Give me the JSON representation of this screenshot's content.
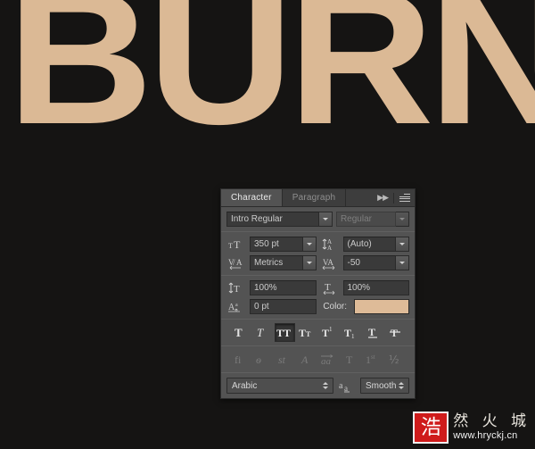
{
  "canvas": {
    "background_color": "#151413",
    "artwork_text": "BURN",
    "artwork_color": "#dbb995"
  },
  "panel": {
    "tabs": [
      {
        "label": "Character",
        "active": true
      },
      {
        "label": "Paragraph",
        "active": false
      }
    ],
    "header_icons": {
      "collapse": "double-chevron-right-icon",
      "menu": "panel-menu-icon"
    },
    "font": {
      "family_value": "Intro  Regular",
      "style_value": "Regular",
      "style_disabled": true
    },
    "metrics": {
      "size_icon": "font-size-icon",
      "size_value": "350 pt",
      "leading_icon": "leading-icon",
      "leading_value": "(Auto)",
      "kerning_icon": "kerning-icon",
      "kerning_value": "Metrics",
      "tracking_icon": "tracking-icon",
      "tracking_value": "-50"
    },
    "scaling": {
      "vertical_icon": "vertical-scale-icon",
      "vertical_value": "100%",
      "horizontal_icon": "horizontal-scale-icon",
      "horizontal_value": "100%",
      "baseline_icon": "baseline-shift-icon",
      "baseline_value": "0 pt",
      "color_label": "Color:",
      "color_value": "#debb98"
    },
    "style_buttons": [
      {
        "name": "faux-bold",
        "glyph": "T",
        "active": false,
        "enabled": true
      },
      {
        "name": "faux-italic",
        "glyph": "T",
        "active": false,
        "enabled": true
      },
      {
        "name": "all-caps",
        "glyph": "TT",
        "active": true,
        "enabled": true
      },
      {
        "name": "small-caps",
        "glyph": "TT",
        "active": false,
        "enabled": true
      },
      {
        "name": "superscript",
        "glyph": "T1",
        "active": false,
        "enabled": true
      },
      {
        "name": "subscript",
        "glyph": "T1",
        "active": false,
        "enabled": true
      },
      {
        "name": "underline",
        "glyph": "T",
        "active": false,
        "enabled": true
      },
      {
        "name": "strikethrough",
        "glyph": "T",
        "active": false,
        "enabled": true
      }
    ],
    "opentype_buttons": [
      {
        "name": "standard-ligatures",
        "glyph": "fi",
        "enabled": false
      },
      {
        "name": "discretionary-ligatures",
        "glyph": "ѳ",
        "enabled": false
      },
      {
        "name": "contextual-alternates",
        "glyph": "st",
        "enabled": false
      },
      {
        "name": "swash",
        "glyph": "A",
        "enabled": false
      },
      {
        "name": "stylistic-alternates",
        "glyph": "aa",
        "enabled": false
      },
      {
        "name": "titling-alternates",
        "glyph": "T",
        "enabled": false
      },
      {
        "name": "ordinals",
        "glyph": "1st",
        "enabled": false
      },
      {
        "name": "fractions",
        "glyph": "½",
        "enabled": false
      }
    ],
    "bottom": {
      "language_value": "Arabic",
      "antialias_icon": "anti-aliasing-icon",
      "antialias_value": "Smooth"
    }
  },
  "watermark": {
    "logo_glyph": "浩",
    "chinese_text": "然 火 城",
    "url": "www.hryckj.cn",
    "logo_color": "#cf1b1b"
  }
}
